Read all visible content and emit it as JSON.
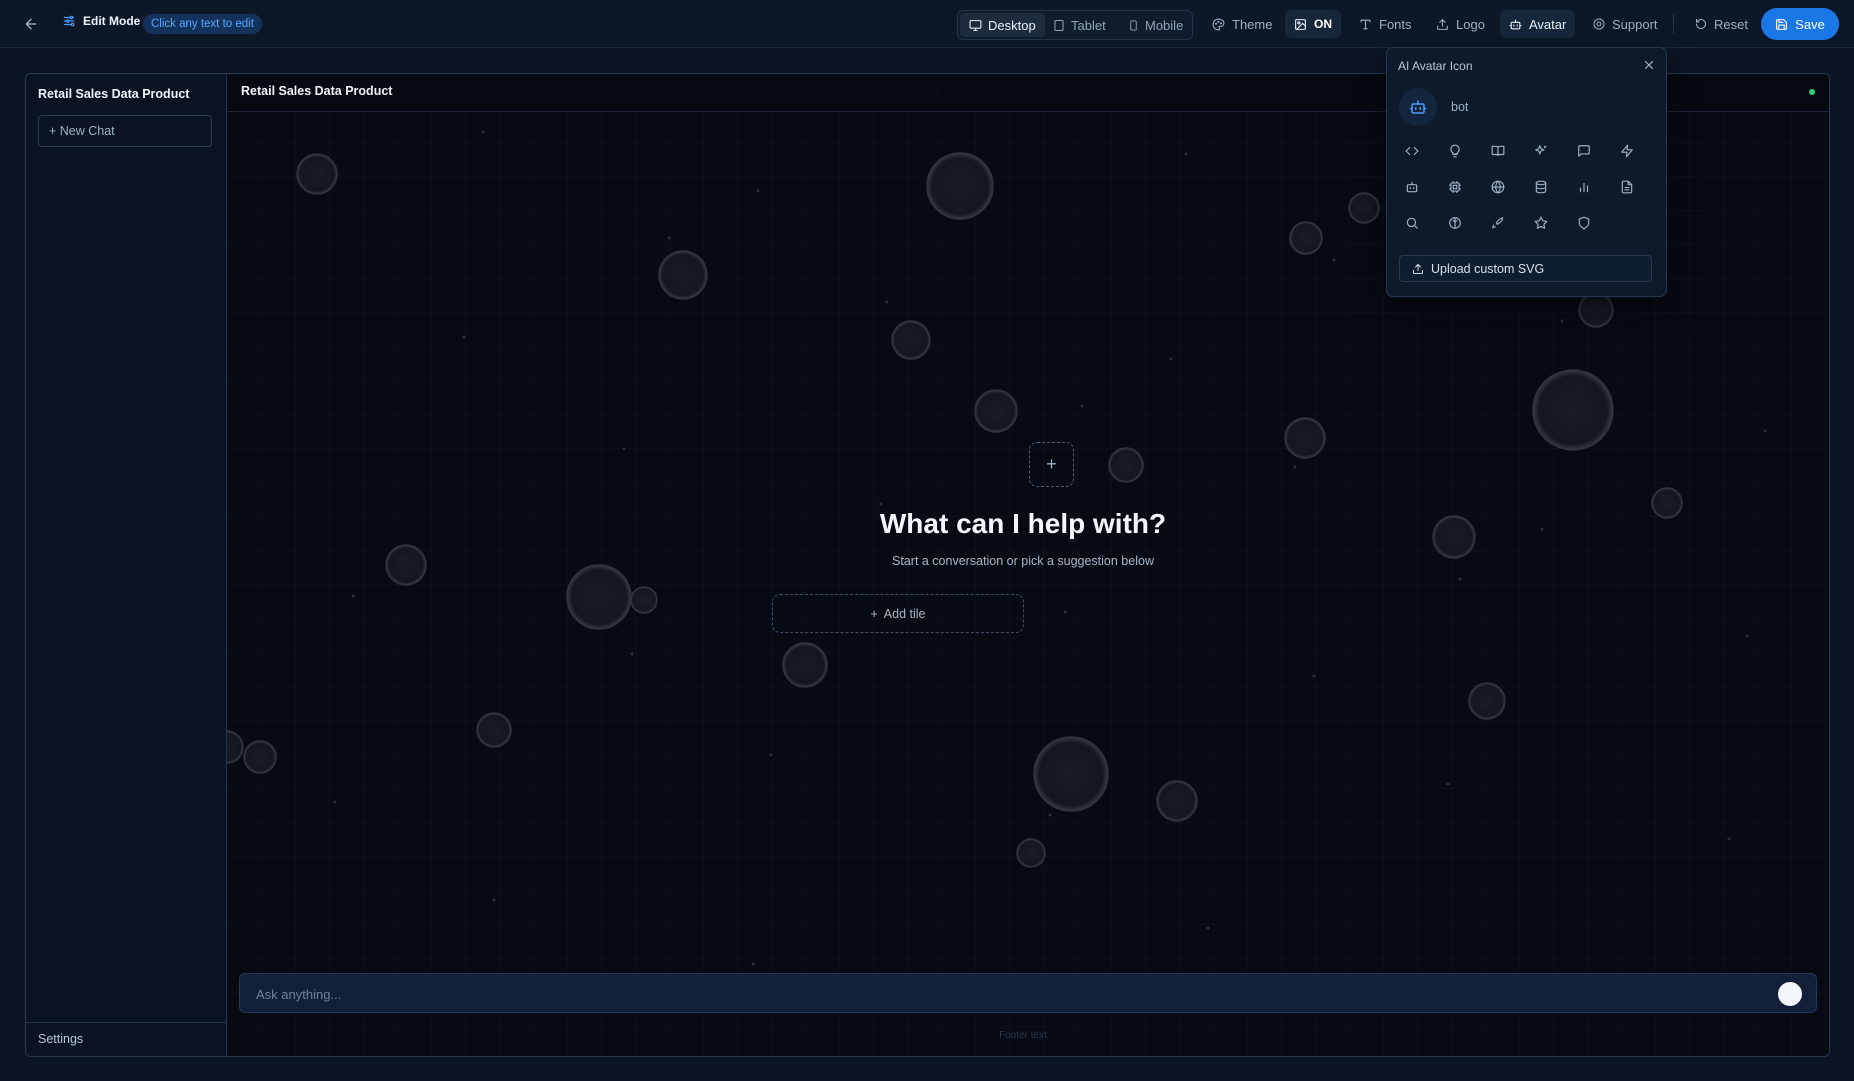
{
  "topbar": {
    "edit_mode_label": "Edit Mode",
    "edit_hint": "Click any text to edit",
    "devices": [
      {
        "label": "Desktop",
        "active": true
      },
      {
        "label": "Tablet",
        "active": false
      },
      {
        "label": "Mobile",
        "active": false
      }
    ],
    "background_toggle": "ON",
    "theme_label": "Theme",
    "fonts_label": "Fonts",
    "logo_label": "Logo",
    "avatar_label": "Avatar",
    "support_label": "Support",
    "reset_label": "Reset",
    "save_label": "Save"
  },
  "sidebar": {
    "title": "Retail Sales Data Product",
    "new_chat_label": "+ New Chat",
    "settings_label": "Settings"
  },
  "main": {
    "title": "Retail Sales Data Product",
    "headline": "What can I help with?",
    "subline": "Start a conversation or pick a suggestion below",
    "add_tile_label": "Add tile",
    "input_placeholder": "Ask anything...",
    "footer_text": "Footer text"
  },
  "avatar_popover": {
    "title": "AI Avatar Icon",
    "selected_icon": "bot",
    "icons": [
      "code-icon",
      "lightbulb-icon",
      "book-icon",
      "sparkles-icon",
      "message-icon",
      "zap-icon",
      "bot-icon",
      "cpu-icon",
      "globe-icon",
      "database-icon",
      "bar-chart-icon",
      "file-text-icon",
      "search-icon",
      "brain-icon",
      "rocket-icon",
      "star-icon",
      "shield-icon"
    ],
    "upload_label": "Upload custom SVG"
  },
  "colors": {
    "accent": "#1a78e6",
    "background": "#0b1525",
    "status_online": "#2fd07b"
  }
}
